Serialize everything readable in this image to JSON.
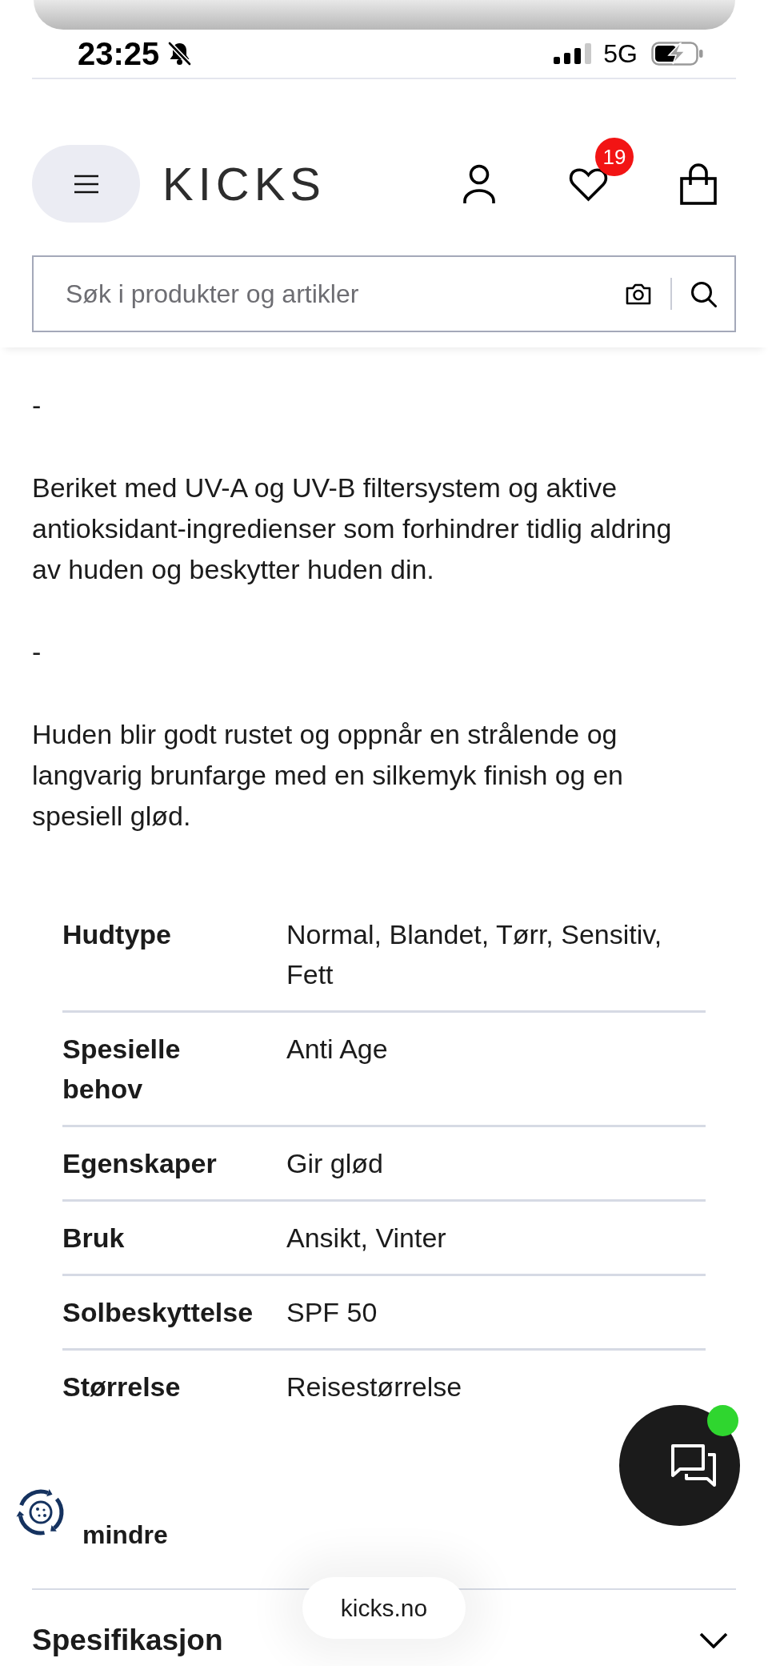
{
  "status_bar": {
    "time": "23:25",
    "network": "5G"
  },
  "header": {
    "logo": "KICKS",
    "wishlist_count": "19",
    "search": {
      "placeholder": "Søk i produkter og artikler"
    }
  },
  "description": [
    "-",
    "Beriket med UV-A og UV-B filtersystem og aktive antioksidant-ingredienser som forhindrer tidlig aldring av huden og beskytter huden din.",
    "-",
    "Huden blir godt rustet og oppnår en strålende og langvarig brunfarge med en silkemyk finish og en spesiell glød."
  ],
  "properties": [
    {
      "label": "Hudtype",
      "value": "Normal, Blandet, Tørr, Sensitiv, Fett"
    },
    {
      "label": "Spesielle behov",
      "value": "Anti Age"
    },
    {
      "label": "Egenskaper",
      "value": "Gir glød"
    },
    {
      "label": "Bruk",
      "value": "Ansikt, Vinter"
    },
    {
      "label": "Solbeskyttelse",
      "value": "SPF 50"
    },
    {
      "label": "Størrelse",
      "value": "Reisestørrelse"
    }
  ],
  "show_less_link": "mindre",
  "chat_button": {
    "online": true
  },
  "accordion": [
    {
      "title": "Spesifikasjon",
      "expanded": false
    }
  ],
  "address_bar": {
    "url": "kicks.no"
  }
}
